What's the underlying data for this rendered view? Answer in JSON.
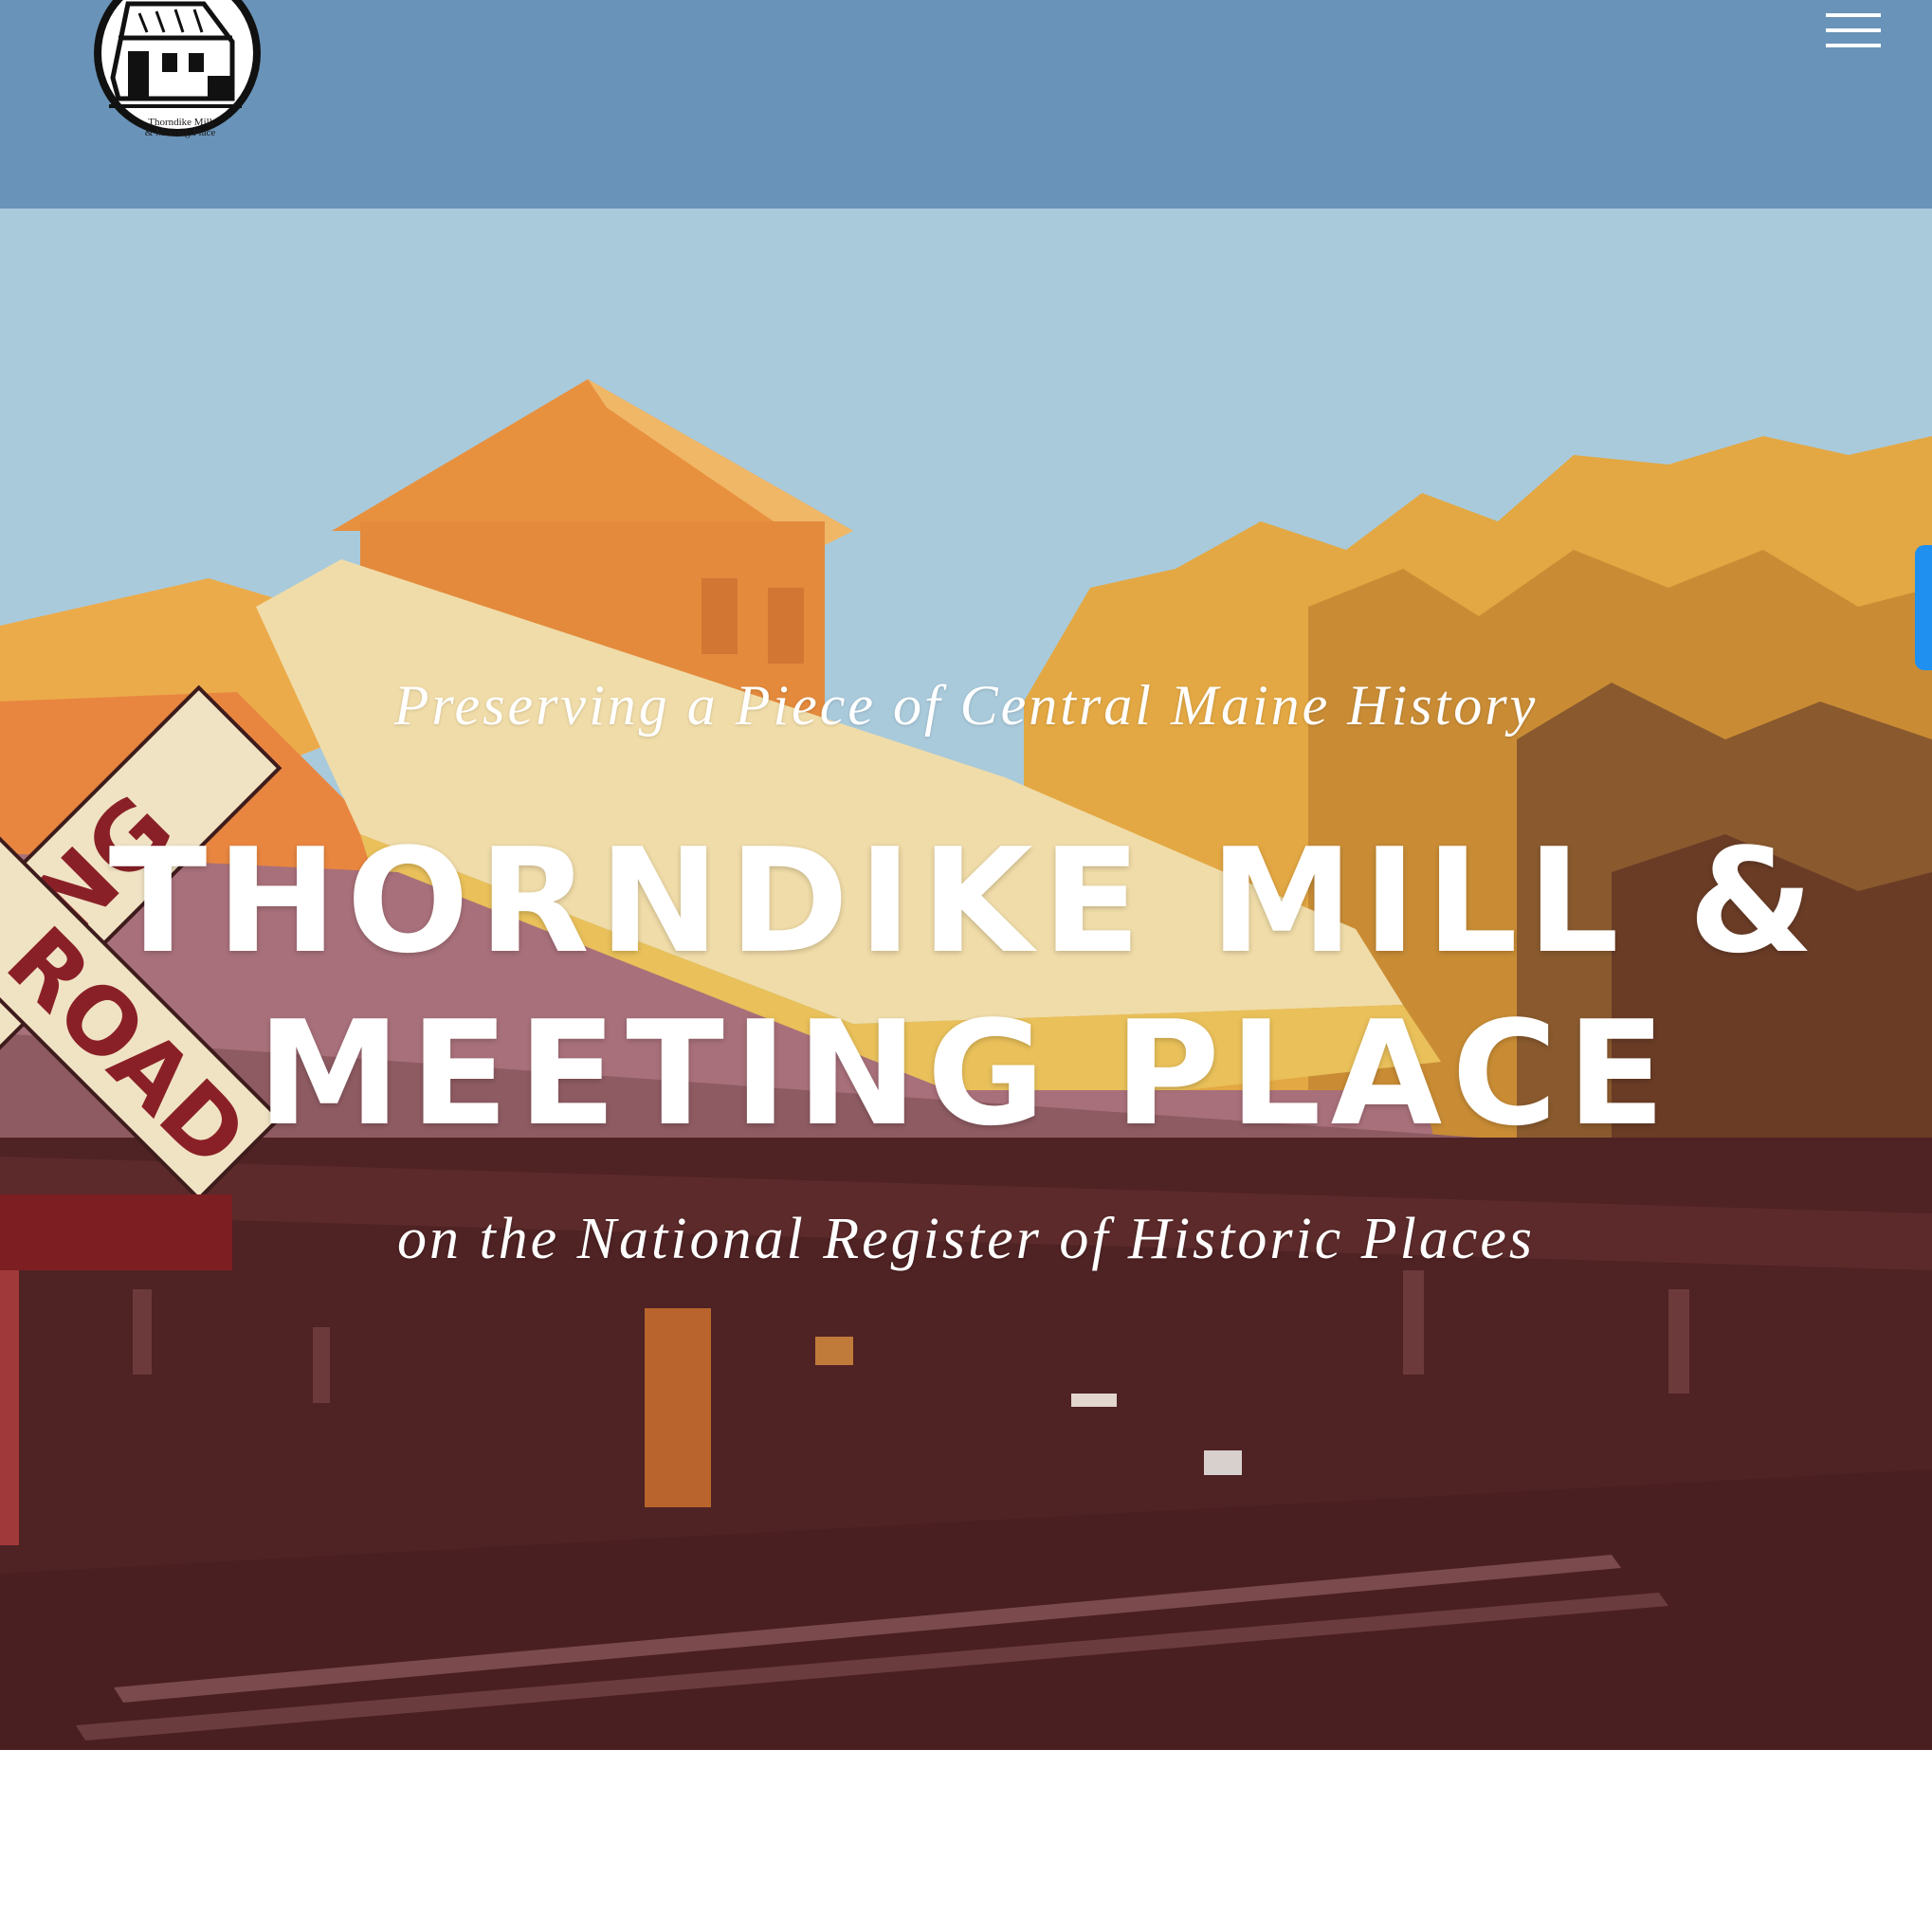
{
  "header": {
    "background_color": "#6993b8",
    "logo": {
      "icon": "mill-building-seal",
      "caption_line1": "Thorndike Mill",
      "caption_line2": "& Meeting Place"
    },
    "menu_icon": "hamburger-menu-icon"
  },
  "hero": {
    "tagline_top": "Preserving a Piece of Central Maine History",
    "title_line1": "THORNDIKE MILL &",
    "title_line2": "MEETING PLACE",
    "tagline_bottom": "on the National Register of Historic Places",
    "sign_text_top": "ING",
    "sign_text_bottom": "ROAD",
    "colors": {
      "sky": "#a9cadb",
      "roof_orange": "#e7913f",
      "roof_cream": "#f0dca8",
      "foliage_gold": "#e9b43c",
      "building_maroon": "#4f2224"
    }
  }
}
